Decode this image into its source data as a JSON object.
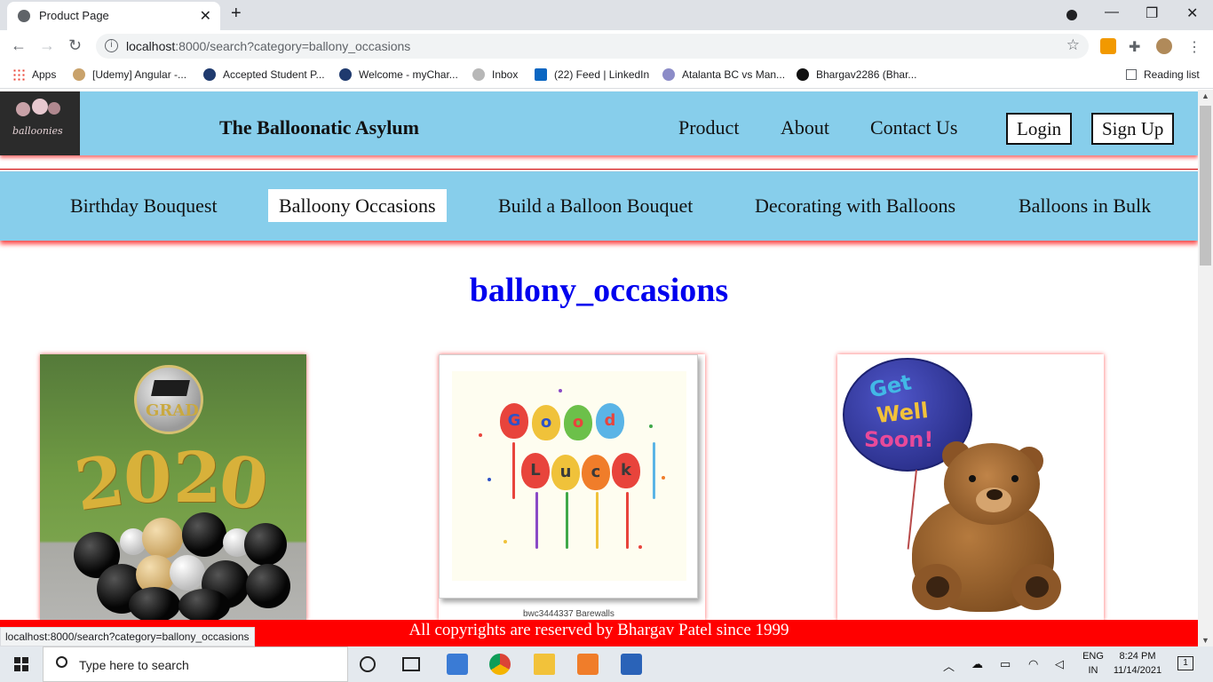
{
  "browser": {
    "tab_title": "Product Page",
    "url_host": "localhost",
    "url_rest": ":8000/search?category=ballony_occasions",
    "bookmarks": [
      {
        "label": "Apps"
      },
      {
        "label": "[Udemy] Angular -..."
      },
      {
        "label": "Accepted Student P..."
      },
      {
        "label": "Welcome - myChar..."
      },
      {
        "label": "Inbox"
      },
      {
        "label": "(22) Feed | LinkedIn"
      },
      {
        "label": "Atalanta BC vs Man..."
      },
      {
        "label": "Bhargav2286 (Bhar..."
      }
    ],
    "reading_list": "Reading list"
  },
  "site": {
    "logo_text": "balloonies",
    "brand": "The Balloonatic Asylum",
    "nav": [
      "Product",
      "About",
      "Contact Us"
    ],
    "login": "Login",
    "signup": "Sign Up",
    "categories": [
      "Birthday Bouquest",
      "Balloony Occasions",
      "Build a Balloon Bouquet",
      "Decorating with Balloons",
      "Balloons in Bulk"
    ],
    "active_category": "Balloony Occasions",
    "heading": "ballony_occasions",
    "products": [
      {
        "image": "2020 graduation balloon bouquet",
        "grad_text": "GRAD",
        "digits": [
          "2",
          "0",
          "2",
          "0"
        ]
      },
      {
        "image": "Good Luck balloons",
        "letters_top": [
          "G",
          "o",
          "o",
          "d"
        ],
        "letters_bottom": [
          "L",
          "u",
          "c",
          "k"
        ],
        "caption": "bwc3444337 Barewalls"
      },
      {
        "image": "Get Well Soon balloon with teddy bear",
        "balloon_text": [
          "Get",
          "Well",
          "Soon!"
        ]
      }
    ],
    "footer": "All copyrights are reserved by Bhargav Patel since 1999",
    "status_url": "localhost:8000/search?category=ballony_occasions"
  },
  "taskbar": {
    "search_placeholder": "Type here to search",
    "lang_top": "ENG",
    "lang_bottom": "IN",
    "time": "8:24 PM",
    "date": "11/14/2021",
    "notification_count": "1"
  },
  "colors": {
    "header_bg": "#87ceeb",
    "heading": "#0000ee",
    "footer_bg": "#ff0000"
  }
}
